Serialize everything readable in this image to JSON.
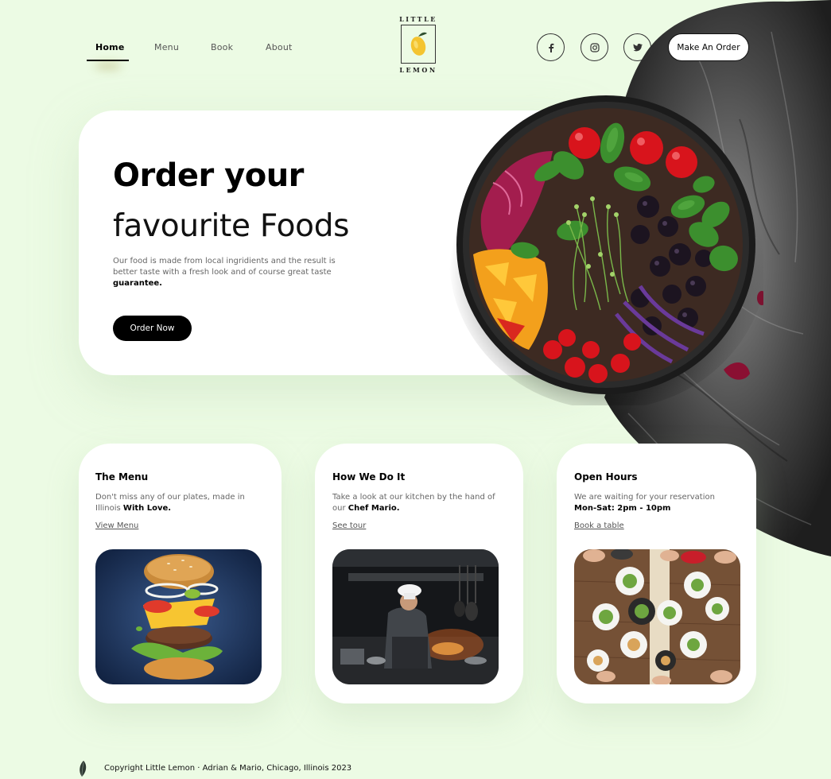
{
  "nav": {
    "links": [
      "Home",
      "Menu",
      "Book",
      "About"
    ],
    "active": "Home",
    "cta": "Make An Order"
  },
  "logo": {
    "top": "LITTLE",
    "bottom": "LEMON"
  },
  "social": [
    "facebook-icon",
    "instagram-icon",
    "twitter-icon"
  ],
  "hero": {
    "title_bold": "Order your",
    "title_light": "favourite Foods",
    "desc": "Our food is made from local ingridients and the result is better taste with a fresh look and of course great taste",
    "desc_bold": "guarantee.",
    "button": "Order Now"
  },
  "cards": [
    {
      "title": "The Menu",
      "text": "Don't miss any of our plates, made in Illinois",
      "text_bold": "With Love.",
      "link": "View Menu"
    },
    {
      "title": "How We Do It",
      "text": "Take a look at our kitchen by the hand of our",
      "text_bold": "Chef Mario.",
      "link": "See tour"
    },
    {
      "title": "Open Hours",
      "text": "We are waiting for your reservation",
      "text_bold": "Mon-Sat: 2pm - 10pm",
      "link": "Book a table"
    }
  ],
  "footer": {
    "text": "Copyright Little Lemon · Adrian & Mario, Chicago, Illinois 2023"
  },
  "colors": {
    "background": "#ecfbe4",
    "card": "#ffffff",
    "accent": "#f4c430",
    "button": "#000000"
  }
}
